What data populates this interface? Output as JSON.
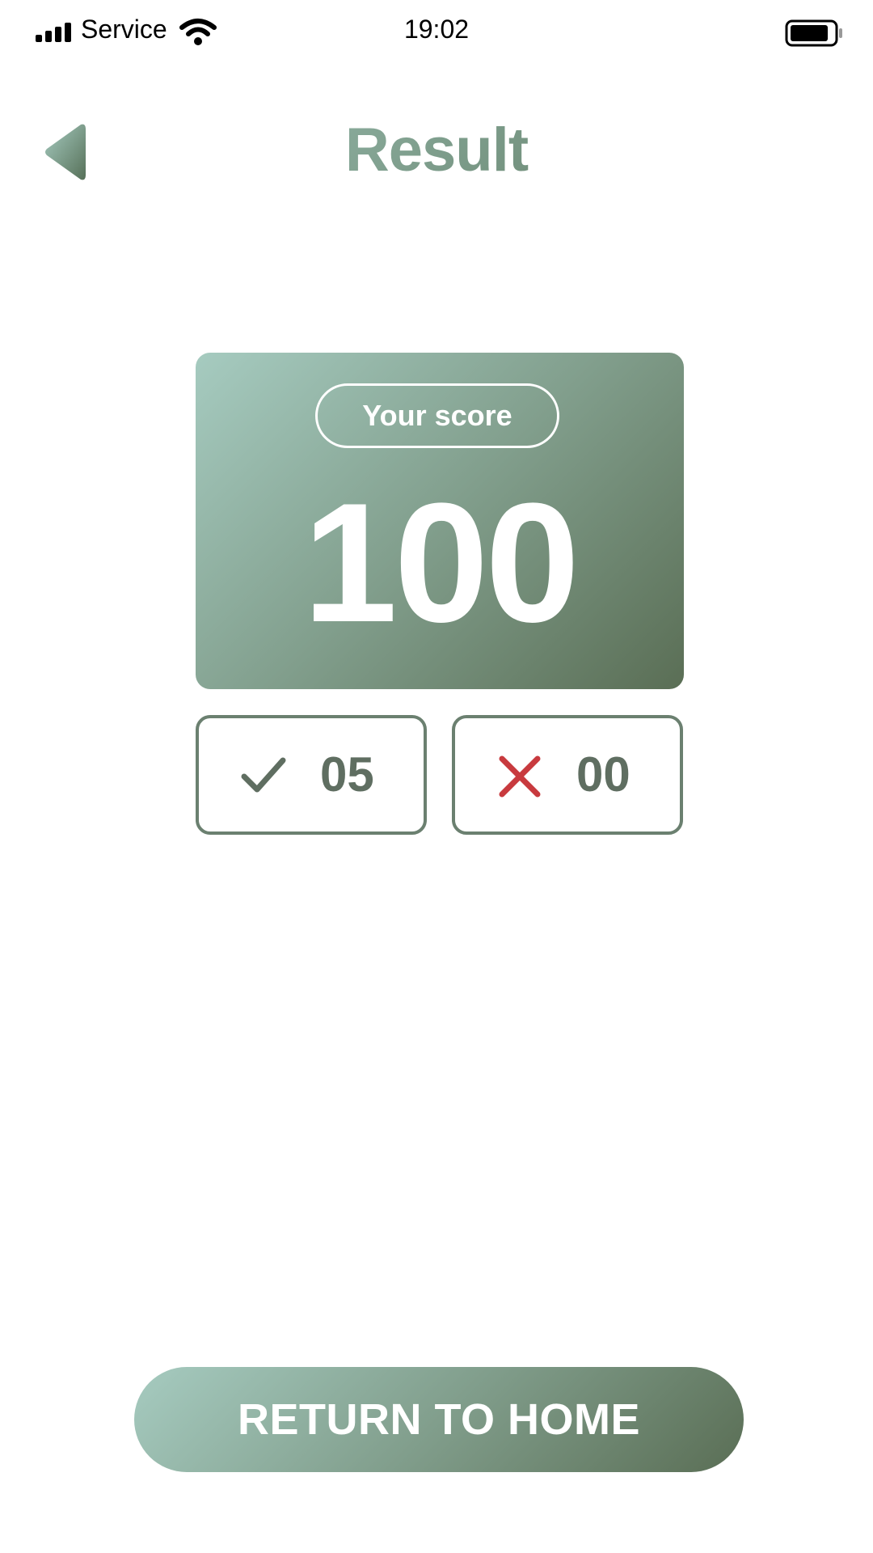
{
  "status_bar": {
    "carrier": "Service",
    "time": "19:02"
  },
  "header": {
    "title": "Result",
    "back_icon": "back-triangle-icon"
  },
  "score_card": {
    "label": "Your score",
    "score": "100"
  },
  "counts": {
    "correct": {
      "icon": "check-icon",
      "value": "05",
      "color": "#5f6e61"
    },
    "wrong": {
      "icon": "close-icon",
      "value": "00",
      "color": "#c83a3e"
    }
  },
  "actions": {
    "home_label": "RETURN TO HOME"
  },
  "colors": {
    "gradient_start": "#a6cbc0",
    "gradient_end": "#567058",
    "border": "#6b8070"
  }
}
